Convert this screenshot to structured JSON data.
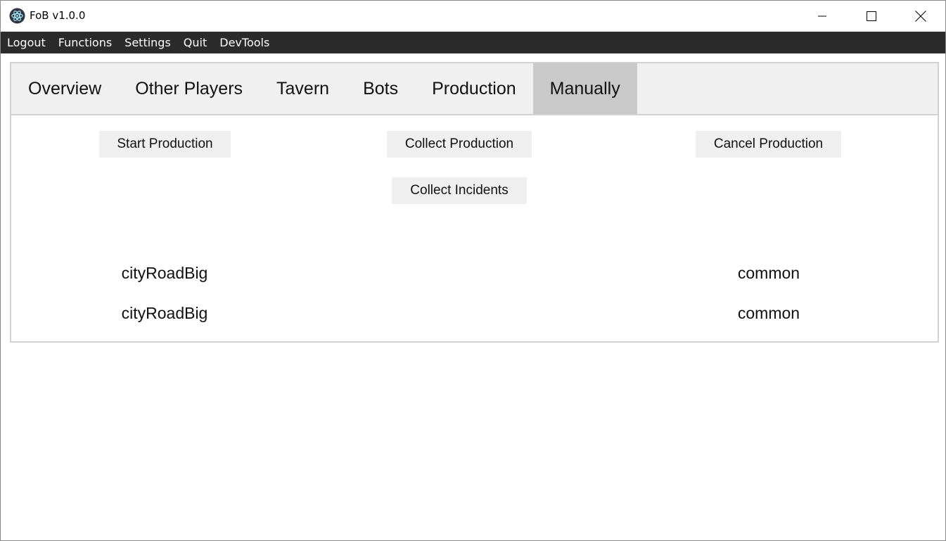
{
  "window": {
    "title": "FoB v1.0.0",
    "app_icon": "electron-atom-icon",
    "controls": {
      "minimize_icon": "minimize-icon",
      "maximize_icon": "maximize-icon",
      "close_icon": "close-icon"
    }
  },
  "menubar": {
    "items": [
      "Logout",
      "Functions",
      "Settings",
      "Quit",
      "DevTools"
    ]
  },
  "tabs": {
    "items": [
      "Overview",
      "Other Players",
      "Tavern",
      "Bots",
      "Production",
      "Manually"
    ],
    "active": "Manually"
  },
  "actions": {
    "start_production": "Start Production",
    "collect_production": "Collect Production",
    "cancel_production": "Cancel Production",
    "collect_incidents": "Collect Incidents"
  },
  "rows": [
    {
      "name": "cityRoadBig",
      "type": "common"
    },
    {
      "name": "cityRoadBig",
      "type": "common"
    }
  ],
  "colors": {
    "menubar_bg": "#2b2b2b",
    "tabbar_bg": "#f0f0f0",
    "active_tab_bg": "#c9c9c9",
    "button_bg": "#efefef"
  }
}
